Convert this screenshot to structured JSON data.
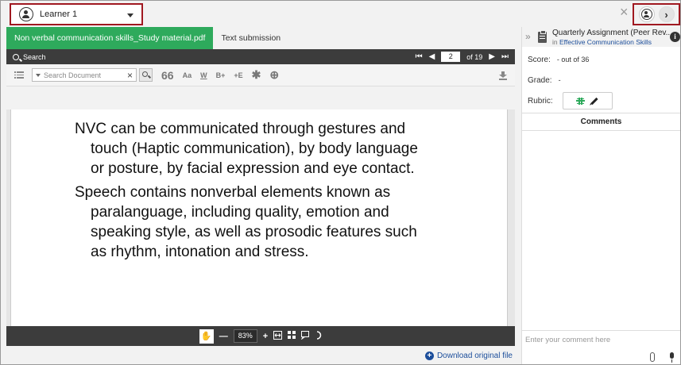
{
  "topbar": {
    "learner_name": "Learner 1",
    "close_glyph": "×",
    "next_glyph": "›"
  },
  "tabs": [
    {
      "label": "Non verbal communication skills_Study material.pdf",
      "active": true
    },
    {
      "label": "Text submission",
      "active": false
    }
  ],
  "viewer_toolbar": {
    "search_label": "Search",
    "page_current": "2",
    "page_total_label": "of 19",
    "search_placeholder": "Search Document",
    "tools": [
      "66",
      "Aa",
      "W",
      "B+",
      "+E",
      "✱",
      "⊕"
    ],
    "icons": [
      "list-icon",
      "search-icon",
      "quote-icon",
      "font-case-icon",
      "underline-icon",
      "bold-icon",
      "superscript-icon",
      "asterisk-icon",
      "target-icon",
      "download-icon"
    ]
  },
  "document": {
    "paragraph1": [
      "NVC can be communicated through gestures and",
      "touch (Haptic communication), by body language",
      "or posture, by facial expression and eye contact."
    ],
    "paragraph2": [
      "Speech contains nonverbal elements known as",
      "paralanguage, including quality, emotion and",
      "speaking style, as well as prosodic features such",
      "as rhythm, intonation and stress."
    ]
  },
  "bottom_toolbar": {
    "zoom": "83%"
  },
  "download_original_label": "Download original file",
  "assignment": {
    "title": "Quarterly Assignment (Peer Rev...",
    "in_label": "in",
    "course": "Effective Communication Skills",
    "score_label": "Score:",
    "score_value": "- out of 36",
    "grade_label": "Grade:",
    "grade_value": "-",
    "rubric_label": "Rubric:",
    "comments_header": "Comments",
    "comment_placeholder": "Enter your comment here"
  },
  "colors": {
    "accent_green": "#2eaa5c",
    "highlight_red": "#a01820",
    "link_blue": "#1c4e9b",
    "toolbar_dark": "#3c3c3c"
  }
}
